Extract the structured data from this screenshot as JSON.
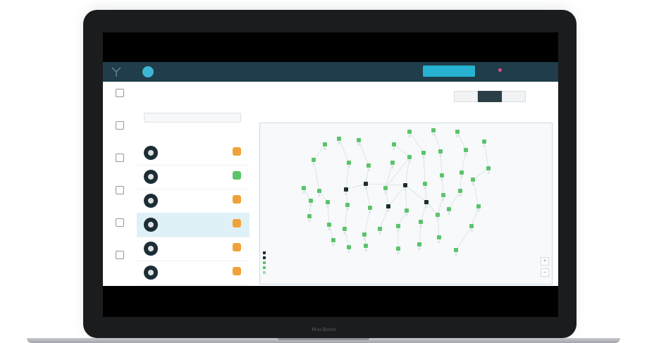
{
  "device": {
    "brand_label": "MacBook"
  },
  "app": {
    "header": {
      "brand_name": "",
      "brand_sub": "",
      "cta_label": "",
      "link_1": "",
      "link_2": ""
    },
    "nav": [
      {
        "label": ""
      },
      {
        "label": ""
      },
      {
        "label": ""
      },
      {
        "label": ""
      },
      {
        "label": ""
      },
      {
        "label": ""
      }
    ],
    "list": {
      "title": "",
      "count": "",
      "filter_placeholder": "",
      "subtabs": [
        "",
        "",
        ""
      ],
      "rows": [
        {
          "name": "",
          "sub": "",
          "badge_color": "#f0a23a"
        },
        {
          "name": "",
          "sub": "",
          "badge_color": "#5bc46b"
        },
        {
          "name": "",
          "sub": "",
          "badge_color": "#f0a23a"
        },
        {
          "name": "",
          "sub": "",
          "badge_color": "#f0a23a",
          "selected": true
        },
        {
          "name": "",
          "sub": "",
          "badge_color": "#f0a23a"
        },
        {
          "name": "",
          "sub": "",
          "badge_color": "#f0a23a"
        }
      ]
    },
    "main": {
      "title": "",
      "segments": [
        "",
        "",
        ""
      ],
      "crumbs": [
        "",
        "",
        ""
      ],
      "links": [
        "",
        ""
      ],
      "legend": [
        {
          "label": "",
          "color": "#1d2d35"
        },
        {
          "label": "",
          "color": "#1d2d35"
        },
        {
          "label": "",
          "color": "#5bc46b"
        },
        {
          "label": "",
          "color": "#5bc46b"
        },
        {
          "label": "",
          "color": "#9fd9a8"
        }
      ]
    }
  },
  "colors": {
    "accent": "#26b2d0",
    "topbar": "#1f3d4a",
    "node_green": "#5bc46b",
    "node_dark": "#1d2d35",
    "badge_orange": "#f0a23a"
  }
}
